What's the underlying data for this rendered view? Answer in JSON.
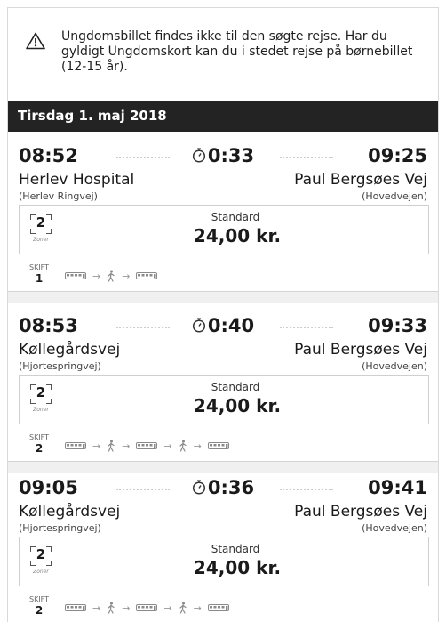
{
  "notice": {
    "icon": "warning-triangle-icon",
    "text": "Ungdomsbillet findes ikke til den søgte rejse. Har du gyldigt Ungdomskort kan du i stedet rejse på børnebillet (12-15 år)."
  },
  "day_header": "Tirsdag 1. maj 2018",
  "journeys": [
    {
      "depart": "08:52",
      "arrive": "09:25",
      "duration": "0:33",
      "from": "Herlev Hospital",
      "from_sub": "(Herlev Ringvej)",
      "to": "Paul Bergsøes Vej",
      "to_sub": "(Hovedvejen)",
      "zones": "2",
      "zones_label": "Zoner",
      "ticket_type": "Standard",
      "price": "24,00 kr.",
      "changes_label": "SKIFT",
      "changes": "1",
      "legs": [
        "bus",
        "walk",
        "bus"
      ]
    },
    {
      "depart": "08:53",
      "arrive": "09:33",
      "duration": "0:40",
      "from": "Køllegårdsvej",
      "from_sub": "(Hjortespringvej)",
      "to": "Paul Bergsøes Vej",
      "to_sub": "(Hovedvejen)",
      "zones": "2",
      "zones_label": "Zoner",
      "ticket_type": "Standard",
      "price": "24,00 kr.",
      "changes_label": "SKIFT",
      "changes": "2",
      "legs": [
        "bus",
        "walk",
        "bus",
        "walk",
        "bus"
      ]
    },
    {
      "depart": "09:05",
      "arrive": "09:41",
      "duration": "0:36",
      "from": "Køllegårdsvej",
      "from_sub": "(Hjortespringvej)",
      "to": "Paul Bergsøes Vej",
      "to_sub": "(Hovedvejen)",
      "zones": "2",
      "zones_label": "Zoner",
      "ticket_type": "Standard",
      "price": "24,00 kr.",
      "changes_label": "SKIFT",
      "changes": "2",
      "legs": [
        "bus",
        "walk",
        "bus",
        "walk",
        "bus"
      ]
    }
  ],
  "colors": {
    "header_bg": "#232323",
    "separator": "#f0f0f0",
    "border": "#cfcfcf"
  }
}
